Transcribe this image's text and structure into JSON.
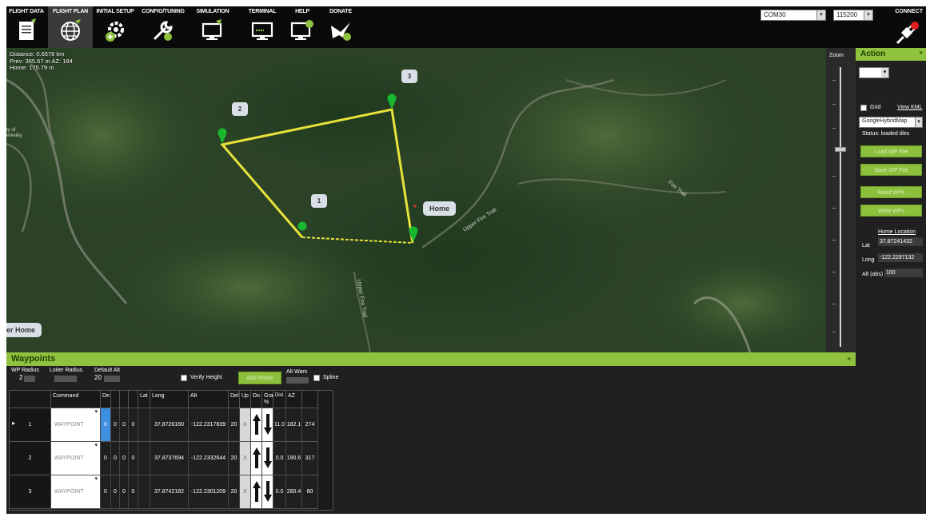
{
  "menu": [
    {
      "label": "FLIGHT DATA",
      "icon": "flight-data-icon"
    },
    {
      "label": "FLIGHT PLAN",
      "icon": "globe-icon"
    },
    {
      "label": "INITIAL SETUP",
      "icon": "initial-setup-icon"
    },
    {
      "label": "CONFIG/TUNING",
      "icon": "wrench-icon"
    },
    {
      "label": "SIMULATION",
      "icon": "simulation-icon"
    },
    {
      "label": "TERMINAL",
      "icon": "terminal-icon"
    },
    {
      "label": "HELP",
      "icon": "help-icon"
    },
    {
      "label": "DONATE",
      "icon": "donate-icon"
    }
  ],
  "connection": {
    "port": "COM30",
    "baud": "115200",
    "connect_label": "CONNECT"
  },
  "map": {
    "info_distance": "Distance: 0.6578 km",
    "info_prev": "Prev: 365.67 m AZ: 184",
    "info_home": "Home: 175.79 m",
    "waypoint_labels": [
      "1",
      "2",
      "3"
    ],
    "home_label": "Home",
    "offscreen_home_label": "er Home",
    "roads": [
      "Upper Fire Trail",
      "Fire Trail",
      "Upper Fire Trail"
    ],
    "left_edge_text": "ty of\nerkeley"
  },
  "zoom": {
    "label": "Zoom"
  },
  "action": {
    "title": "Action",
    "grid_label": "Grid",
    "view_kml": "View KML",
    "map_type": "GoogleHybridMap",
    "status": "Status: loaded tiles",
    "buttons": [
      "Load WP File",
      "Save WP File",
      "Read WPs",
      "Write WPs"
    ],
    "home_location_title": "Home Location",
    "lat_label": "Lat",
    "lat_value": "37.87241432",
    "long_label": "Long",
    "long_value": "-122.2297132",
    "alt_label": "Alt (abs)",
    "alt_value": "100"
  },
  "waypoints": {
    "title": "Waypoints",
    "wp_radius_label": "WP Radius",
    "wp_radius_value": "2",
    "loiter_radius_label": "Loiter Radius",
    "default_alt_label": "Default Alt",
    "default_alt_value": "20",
    "verify_height_label": "Verify Height",
    "add_below_label": "Add Below",
    "alt_warn_label": "Alt Warn",
    "spline_label": "Spline",
    "columns": [
      "Command",
      "De",
      "",
      "",
      "",
      "Lat",
      "Long",
      "Alt",
      "Del",
      "Up",
      "Do",
      "Grad %",
      "Dist",
      "AZ"
    ],
    "rows": [
      {
        "num": "1",
        "command": "WAYPOINT",
        "p1": "0",
        "p2": "0",
        "p3": "0",
        "p4": "0",
        "lat": "37.8726160",
        "long": "-122.2317839",
        "alt": "20",
        "del": "X",
        "grad": "11.0",
        "dist": "182.1",
        "az": "274"
      },
      {
        "num": "2",
        "command": "WAYPOINT",
        "p1": "0",
        "p2": "0",
        "p3": "0",
        "p4": "0",
        "lat": "37.8737694",
        "long": "-122.2332644",
        "alt": "20",
        "del": "X",
        "grad": "0.0",
        "dist": "190.6",
        "az": "317"
      },
      {
        "num": "3",
        "command": "WAYPOINT",
        "p1": "0",
        "p2": "0",
        "p3": "0",
        "p4": "0",
        "lat": "37.8742182",
        "long": "-122.2301209",
        "alt": "20",
        "del": "X",
        "grad": "0.0",
        "dist": "280.4",
        "az": "80"
      }
    ]
  },
  "colors": {
    "accent_green": "#8fc23f",
    "path_yellow": "#e8e23a",
    "marker_green": "#19b92f"
  }
}
